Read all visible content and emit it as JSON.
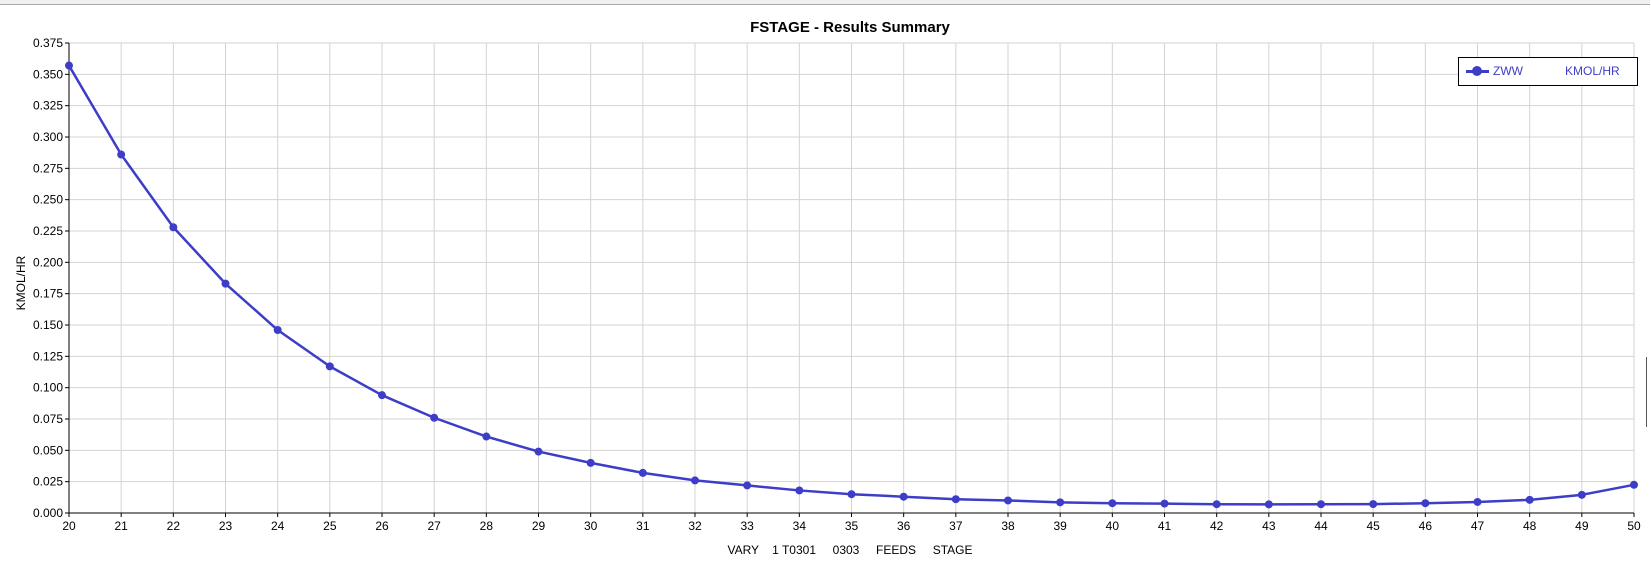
{
  "chart_data": {
    "type": "line",
    "title": "FSTAGE - Results Summary",
    "xlabel": "VARY    1 T0301     0303     FEEDS     STAGE",
    "ylabel": "KMOL/HR",
    "xlim": [
      20,
      50
    ],
    "ylim": [
      0,
      0.375
    ],
    "x_ticks": [
      20,
      21,
      22,
      23,
      24,
      25,
      26,
      27,
      28,
      29,
      30,
      31,
      32,
      33,
      34,
      35,
      36,
      37,
      38,
      39,
      40,
      41,
      42,
      43,
      44,
      45,
      46,
      47,
      48,
      49,
      50
    ],
    "y_ticks": [
      "0.000",
      "0.025",
      "0.050",
      "0.075",
      "0.100",
      "0.125",
      "0.150",
      "0.175",
      "0.200",
      "0.225",
      "0.250",
      "0.275",
      "0.300",
      "0.325",
      "0.350",
      "0.375"
    ],
    "grid": true,
    "legend_position": "top-right",
    "series": [
      {
        "name": "ZWW",
        "unit": "KMOL/HR",
        "color": "#3d3dc8",
        "x": [
          20,
          21,
          22,
          23,
          24,
          25,
          26,
          27,
          28,
          29,
          30,
          31,
          32,
          33,
          34,
          35,
          36,
          37,
          38,
          39,
          40,
          41,
          42,
          43,
          44,
          45,
          46,
          47,
          48,
          49,
          50
        ],
        "y": [
          0.357,
          0.286,
          0.228,
          0.183,
          0.146,
          0.117,
          0.094,
          0.076,
          0.061,
          0.049,
          0.04,
          0.032,
          0.026,
          0.022,
          0.018,
          0.015,
          0.013,
          0.011,
          0.01,
          0.0085,
          0.0078,
          0.0075,
          0.007,
          0.0069,
          0.007,
          0.0071,
          0.0078,
          0.0088,
          0.0105,
          0.0145,
          0.0225
        ]
      }
    ]
  }
}
